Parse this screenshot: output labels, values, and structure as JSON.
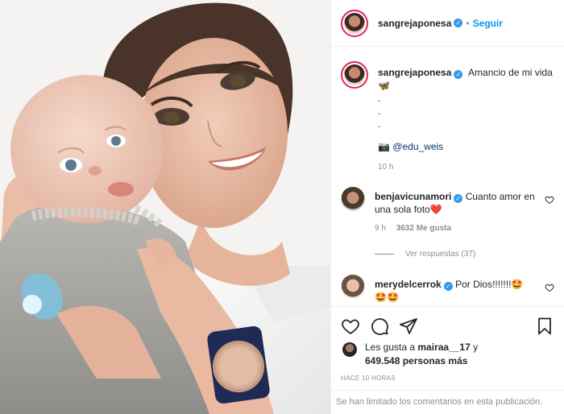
{
  "post": {
    "author": "sangrejaponesa",
    "follow_label": "Seguir",
    "caption_text": "Amancio de mi vida",
    "caption_emoji": "🦋",
    "caption_dots": [
      ".",
      ".",
      "."
    ],
    "credit_emoji": "📷",
    "credit_handle": "@edu_weis",
    "caption_time": "10 h"
  },
  "comments": [
    {
      "user": "benjavicunamori",
      "text": "Cuanto amor en una sola foto",
      "emoji": "❤️",
      "time": "9 h",
      "likes": "3632 Me gusta",
      "replies_label": "Ver respuestas (37)"
    },
    {
      "user": "merydelcerrok",
      "text": "Por Dios!!!!!!!",
      "emoji": "🤩",
      "emoji_line": "🤩🤩"
    }
  ],
  "likes": {
    "prefix": "Les gusta a",
    "user": "mairaa__17",
    "joiner": "y",
    "count": "649.548 personas más"
  },
  "timestamp": "HACE 10 HORAS",
  "comments_limited": "Se han limitado los comentarios en esta publicación.",
  "icons": [
    "heart-icon",
    "comment-icon",
    "share-icon",
    "bookmark-icon",
    "verified-icon",
    "more-icon"
  ],
  "colors": {
    "link": "#0095f6",
    "verified": "#3897f0",
    "muted": "#8e8e8e",
    "watch_band": "#1f2a55",
    "pacifier": "#7cc3e3"
  }
}
